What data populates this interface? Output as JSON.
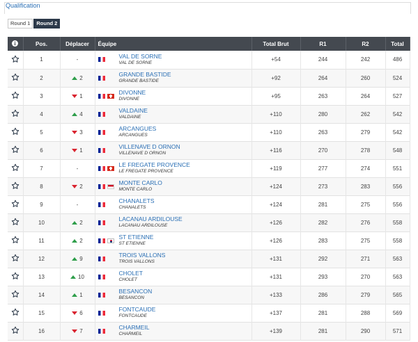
{
  "tabs": {
    "qualification": "Qualification"
  },
  "rounds": [
    "Round 1",
    "Round 2"
  ],
  "active_round": "Round 2",
  "table": {
    "headers": {
      "info": "i",
      "pos": "Pos.",
      "move": "Déplacer",
      "team": "Équipe",
      "total_brut": "Total Brut",
      "r1": "R1",
      "r2": "R2",
      "total": "Total"
    },
    "rows": [
      {
        "pos": "1",
        "dir": "none",
        "move": "-",
        "flags": [
          "fr"
        ],
        "team": "VAL DE SORNE",
        "sub": "VAL DE SORNE",
        "total_brut": "+54",
        "r1": "244",
        "r2": "242",
        "total": "486"
      },
      {
        "pos": "2",
        "dir": "up",
        "move": "2",
        "flags": [
          "fr"
        ],
        "team": "GRANDE BASTIDE",
        "sub": "GRANDE BASTIDE",
        "total_brut": "+92",
        "r1": "264",
        "r2": "260",
        "total": "524"
      },
      {
        "pos": "3",
        "dir": "down",
        "move": "1",
        "flags": [
          "fr",
          "ch"
        ],
        "team": "DIVONNE",
        "sub": "DIVONNE",
        "total_brut": "+95",
        "r1": "263",
        "r2": "264",
        "total": "527"
      },
      {
        "pos": "4",
        "dir": "up",
        "move": "4",
        "flags": [
          "fr"
        ],
        "team": "VALDAINE",
        "sub": "VALDAINE",
        "total_brut": "+110",
        "r1": "280",
        "r2": "262",
        "total": "542"
      },
      {
        "pos": "5",
        "dir": "down",
        "move": "3",
        "flags": [
          "fr"
        ],
        "team": "ARCANGUES",
        "sub": "ARCANGUES",
        "total_brut": "+110",
        "r1": "263",
        "r2": "279",
        "total": "542"
      },
      {
        "pos": "6",
        "dir": "down",
        "move": "1",
        "flags": [
          "fr"
        ],
        "team": "VILLENAVE D ORNON",
        "sub": "VILLENAVE D ORNON",
        "total_brut": "+116",
        "r1": "270",
        "r2": "278",
        "total": "548"
      },
      {
        "pos": "7",
        "dir": "none",
        "move": "-",
        "flags": [
          "fr",
          "ch"
        ],
        "team": "LE FREGATE PROVENCE",
        "sub": "LE FREGATE PROVENCE",
        "total_brut": "+119",
        "r1": "277",
        "r2": "274",
        "total": "551"
      },
      {
        "pos": "8",
        "dir": "down",
        "move": "2",
        "flags": [
          "fr",
          "mc"
        ],
        "team": "MONTE CARLO",
        "sub": "MONTE CARLO",
        "total_brut": "+124",
        "r1": "273",
        "r2": "283",
        "total": "556"
      },
      {
        "pos": "9",
        "dir": "none",
        "move": "-",
        "flags": [
          "fr"
        ],
        "team": "CHANALETS",
        "sub": "CHANALETS",
        "total_brut": "+124",
        "r1": "281",
        "r2": "275",
        "total": "556"
      },
      {
        "pos": "10",
        "dir": "up",
        "move": "2",
        "flags": [
          "fr"
        ],
        "team": "LACANAU ARDILOUSE",
        "sub": "LACANAU ARDILOUSE",
        "total_brut": "+126",
        "r1": "282",
        "r2": "276",
        "total": "558"
      },
      {
        "pos": "11",
        "dir": "up",
        "move": "2",
        "flags": [
          "fr",
          "kr"
        ],
        "team": "ST ETIENNE",
        "sub": "ST ETIENNE",
        "total_brut": "+126",
        "r1": "283",
        "r2": "275",
        "total": "558"
      },
      {
        "pos": "12",
        "dir": "up",
        "move": "9",
        "flags": [
          "fr"
        ],
        "team": "TROIS VALLONS",
        "sub": "TROIS VALLONS",
        "total_brut": "+131",
        "r1": "292",
        "r2": "271",
        "total": "563"
      },
      {
        "pos": "13",
        "dir": "up",
        "move": "10",
        "flags": [
          "fr"
        ],
        "team": "CHOLET",
        "sub": "CHOLET",
        "total_brut": "+131",
        "r1": "293",
        "r2": "270",
        "total": "563"
      },
      {
        "pos": "14",
        "dir": "up",
        "move": "1",
        "flags": [
          "fr"
        ],
        "team": "BESANCON",
        "sub": "BESANCON",
        "total_brut": "+133",
        "r1": "286",
        "r2": "279",
        "total": "565"
      },
      {
        "pos": "15",
        "dir": "down",
        "move": "6",
        "flags": [
          "fr"
        ],
        "team": "FONTCAUDE",
        "sub": "FONTCAUDE",
        "total_brut": "+137",
        "r1": "281",
        "r2": "288",
        "total": "569"
      },
      {
        "pos": "16",
        "dir": "down",
        "move": "7",
        "flags": [
          "fr"
        ],
        "team": "CHARMEIL",
        "sub": "CHARMEIL",
        "total_brut": "+139",
        "r1": "281",
        "r2": "290",
        "total": "571"
      }
    ]
  }
}
